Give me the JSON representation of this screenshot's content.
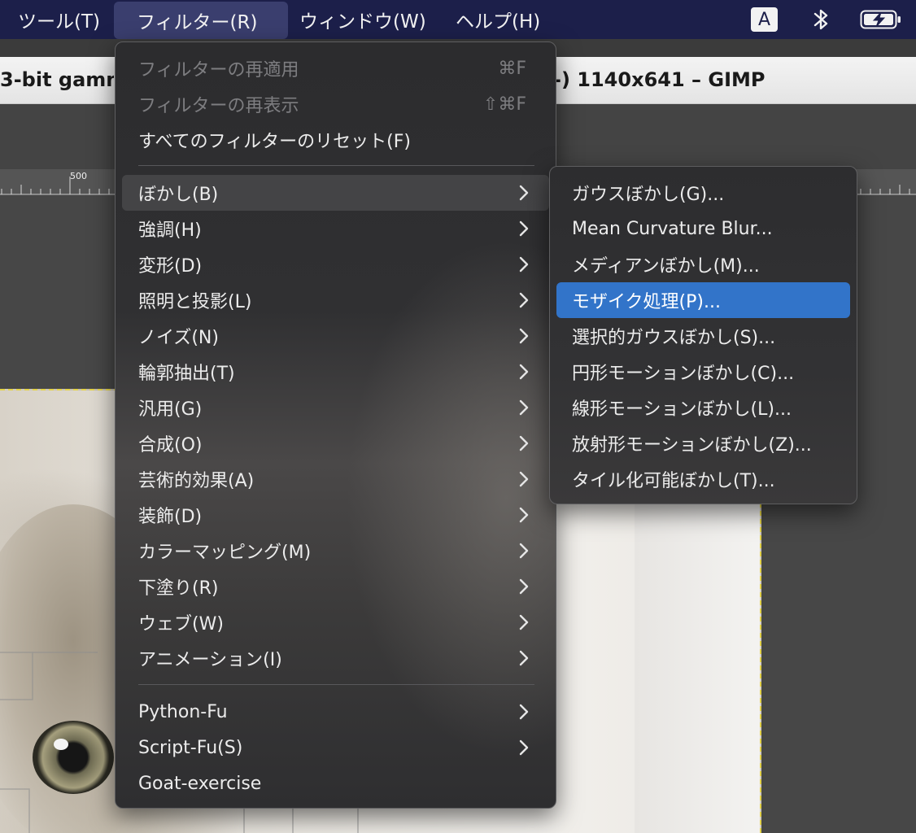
{
  "menubar": {
    "items": [
      {
        "label": "ツール(T)"
      },
      {
        "label": "フィルター(R)"
      },
      {
        "label": "ウィンドウ(W)"
      },
      {
        "label": "ヘルプ(H)"
      }
    ],
    "input_indicator": "A",
    "icons": [
      "bluetooth-icon",
      "battery-charging-icon"
    ]
  },
  "window": {
    "title_left": "3-bit gamm",
    "title_right": "-) 1140x641 – GIMP",
    "ruler_label": "500",
    "selection_color": "#e2d24a"
  },
  "filters_menu": {
    "items": [
      {
        "label": "フィルターの再適用",
        "shortcut": "⌘F",
        "disabled": true
      },
      {
        "label": "フィルターの再表示",
        "shortcut": "⇧⌘F",
        "disabled": true
      },
      {
        "label": "すべてのフィルターのリセット(F)"
      },
      {
        "label": "ぼかし(B)",
        "submenu": true,
        "hover": true
      },
      {
        "label": "強調(H)",
        "submenu": true
      },
      {
        "label": "変形(D)",
        "submenu": true
      },
      {
        "label": "照明と投影(L)",
        "submenu": true
      },
      {
        "label": "ノイズ(N)",
        "submenu": true
      },
      {
        "label": "輪郭抽出(T)",
        "submenu": true
      },
      {
        "label": "汎用(G)",
        "submenu": true
      },
      {
        "label": "合成(O)",
        "submenu": true
      },
      {
        "label": "芸術的効果(A)",
        "submenu": true
      },
      {
        "label": "装飾(D)",
        "submenu": true
      },
      {
        "label": "カラーマッピング(M)",
        "submenu": true
      },
      {
        "label": "下塗り(R)",
        "submenu": true
      },
      {
        "label": "ウェブ(W)",
        "submenu": true
      },
      {
        "label": "アニメーション(I)",
        "submenu": true
      },
      {
        "label": "Python-Fu",
        "submenu": true
      },
      {
        "label": "Script-Fu(S)",
        "submenu": true
      },
      {
        "label": "Goat-exercise"
      }
    ]
  },
  "blur_submenu": {
    "items": [
      {
        "label": "ガウスぼかし(G)..."
      },
      {
        "label": "Mean Curvature Blur..."
      },
      {
        "label": "メディアンぼかし(M)..."
      },
      {
        "label": "モザイク処理(P)...",
        "selected": true
      },
      {
        "label": "選択的ガウスぼかし(S)..."
      },
      {
        "label": "円形モーションぼかし(C)..."
      },
      {
        "label": "線形モーションぼかし(L)..."
      },
      {
        "label": "放射形モーションぼかし(Z)..."
      },
      {
        "label": "タイル化可能ぼかし(T)..."
      }
    ],
    "selected_color": "#3274c9"
  }
}
